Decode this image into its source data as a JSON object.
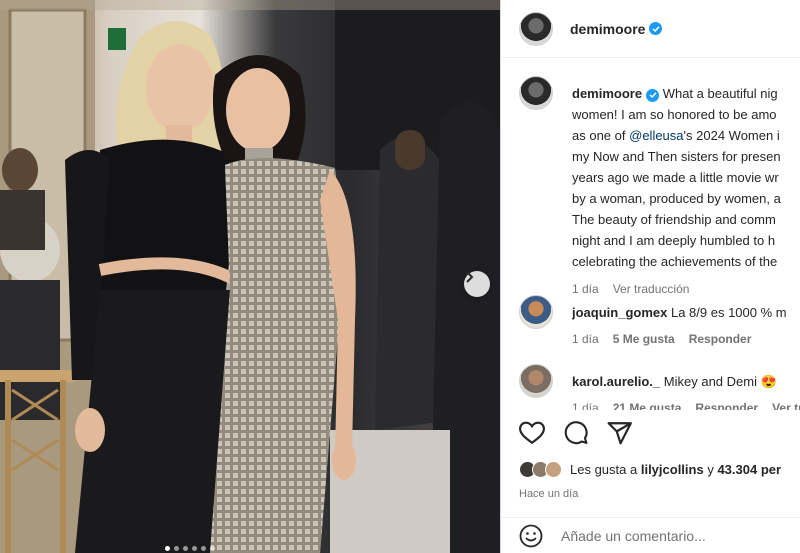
{
  "post": {
    "author": "demimoore",
    "caption_lines": [
      "What a beautiful nig",
      "women! I am so honored to be amo",
      "as one of",
      "'s 2024 Women i",
      "my Now and Then sisters for presen",
      "years ago we made a little movie wr",
      "by a woman, produced by women, a",
      "The beauty of friendship and comm",
      "night and I am deeply humbled to h",
      "celebrating the achievements of the"
    ],
    "caption_mention": "@elleusa",
    "caption_time": "1 día",
    "see_translation": "Ver traducción"
  },
  "comments": [
    {
      "user": "joaquin_gomex",
      "text": "La 8/9 es 1000 % m",
      "time": "1 día",
      "likes": "5 Me gusta",
      "reply": "Responder"
    },
    {
      "user": "karol.aurelio._",
      "text": "Mikey and Demi 😍 ",
      "time": "1 día",
      "likes": "21 Me gusta",
      "reply": "Responder",
      "more": "Ver tr"
    }
  ],
  "likes_line": {
    "prefix": "Les gusta a",
    "user": "lilyjcollins",
    "middle": "y",
    "count": "43.304 per"
  },
  "posted_ago": "Hace un día",
  "add_comment_placeholder": "Añade un comentario...",
  "icons": [
    "heart-icon",
    "comment-icon",
    "share-icon",
    "emoji-icon",
    "verified-icon",
    "chevron-right-icon"
  ],
  "colors": {
    "verified": "#1d9bf0",
    "mention": "#00376b",
    "muted": "#737373"
  }
}
